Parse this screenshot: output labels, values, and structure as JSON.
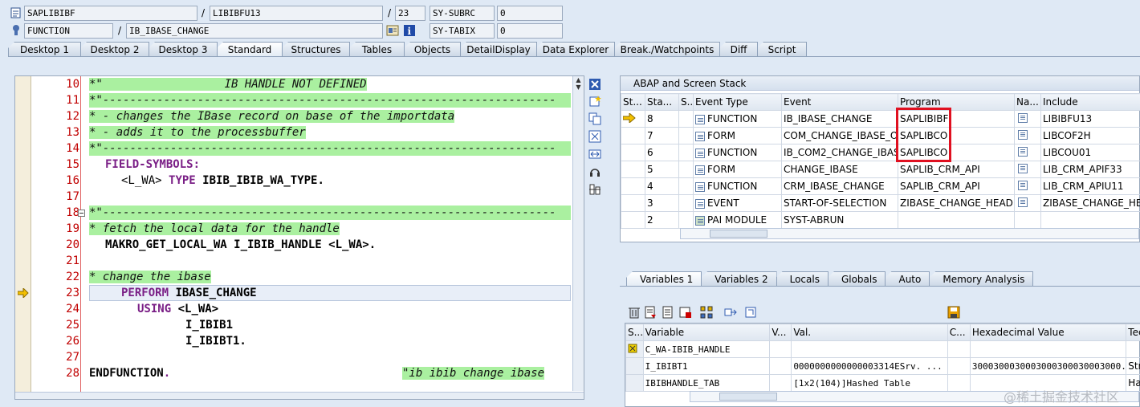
{
  "header": {
    "row1": {
      "program": "SAPLIBIBF",
      "include": "LIBIBFU13",
      "line": "23",
      "sysvar": "SY-SUBRC",
      "sysval": "0"
    },
    "row2": {
      "type": "FUNCTION",
      "name": "IB_IBASE_CHANGE",
      "sysvar": "SY-TABIX",
      "sysval": "0"
    },
    "slash": "/"
  },
  "tabs": [
    "Desktop 1",
    "Desktop 2",
    "Desktop 3",
    "Standard",
    "Structures",
    "Tables",
    "Objects",
    "DetailDisplay",
    "Data Explorer",
    "Break./Watchpoints",
    "Diff",
    "Script"
  ],
  "active_tab": "Standard",
  "code": {
    "line_numbers": [
      "10",
      "11",
      "12",
      "13",
      "14",
      "15",
      "16",
      "17",
      "18",
      "19",
      "20",
      "21",
      "22",
      "23",
      "24",
      "25",
      "26",
      "27",
      "28"
    ],
    "l10": "*\"                  IB HANDLE NOT DEFINED",
    "l11": "*\"-------------------------------------------------------------------",
    "l12": "* - changes the IBase record on base of the importdata",
    "l13": "* - adds it to the processbuffer",
    "l14": "*\"-------------------------------------------------------------------",
    "l15_kw": "FIELD-SYMBOLS",
    "l15_rest": ":",
    "l16_a": "<L_WA>",
    "l16_kw": "TYPE",
    "l16_b": "IBIB_IBIB_WA_TYPE.",
    "l18": "*\"-------------------------------------------------------------------",
    "l19": "* fetch the local data for the handle",
    "l20": "MAKRO_GET_LOCAL_WA I_IBIB_HANDLE <L_WA>.",
    "l22": "* change the ibase",
    "l23_kw": "PERFORM",
    "l23_rest": "IBASE_CHANGE",
    "l24_kw": "USING",
    "l24_rest": "<L_WA>",
    "l25": "I_IBIB1",
    "l26": "I_IBIBT1.",
    "l28_kw": "ENDFUNCTION",
    "l28_dot": ".",
    "l28_cmt": "\"ib ibib change ibase"
  },
  "stack": {
    "title": "ABAP and Screen Stack",
    "columns": [
      "St...",
      "Sta...",
      "S...",
      "Event Type",
      "Event",
      "Program",
      "Na...",
      "Include"
    ],
    "rows": [
      {
        "level": "8",
        "type": "FUNCTION",
        "event": "IB_IBASE_CHANGE",
        "program": "SAPLIBIBF",
        "include": "LIBIBFU13",
        "current": true
      },
      {
        "level": "7",
        "type": "FORM",
        "event": "COM_CHANGE_IBASE_O...",
        "program": "SAPLIBCO",
        "include": "LIBCOF2H",
        "current": false
      },
      {
        "level": "6",
        "type": "FUNCTION",
        "event": "IB_COM2_CHANGE_IBAS...",
        "program": "SAPLIBCO",
        "include": "LIBCOU01",
        "current": false
      },
      {
        "level": "5",
        "type": "FORM",
        "event": "CHANGE_IBASE",
        "program": "SAPLIB_CRM_API",
        "include": "LIB_CRM_APIF33",
        "current": false
      },
      {
        "level": "4",
        "type": "FUNCTION",
        "event": "CRM_IBASE_CHANGE",
        "program": "SAPLIB_CRM_API",
        "include": "LIB_CRM_APIU11",
        "current": false
      },
      {
        "level": "3",
        "type": "EVENT",
        "event": "START-OF-SELECTION",
        "program": "ZIBASE_CHANGE_HEADE...",
        "include": "ZIBASE_CHANGE_HEA",
        "current": false
      },
      {
        "level": "2",
        "type": "PAI MODULE",
        "event": "SYST-ABRUN",
        "program": "",
        "include": "",
        "current": false
      }
    ]
  },
  "var_tabs": [
    "Variables 1",
    "Variables 2",
    "Locals",
    "Globals",
    "Auto",
    "Memory Analysis"
  ],
  "active_var_tab": "Variables 1",
  "variables": {
    "columns": [
      "S...",
      "Variable",
      "V...",
      "Val.",
      "C...",
      "Hexadecimal Value",
      "Techni"
    ],
    "rows": [
      {
        "name": "C_WA-IBIB_HANDLE",
        "value": "",
        "hex": "",
        "tech": ""
      },
      {
        "name": "I_IBIBT1",
        "value": "0000000000000003314ESrv. ...",
        "hex": "3000300030003000300030003000...",
        "tech": "Structu"
      },
      {
        "name": "IBIBHANDLE_TAB",
        "value": "[1x2(104)]Hashed Table",
        "hex": "",
        "tech": "Hashed"
      }
    ]
  },
  "watermark": "@稀土掘金技术社区"
}
